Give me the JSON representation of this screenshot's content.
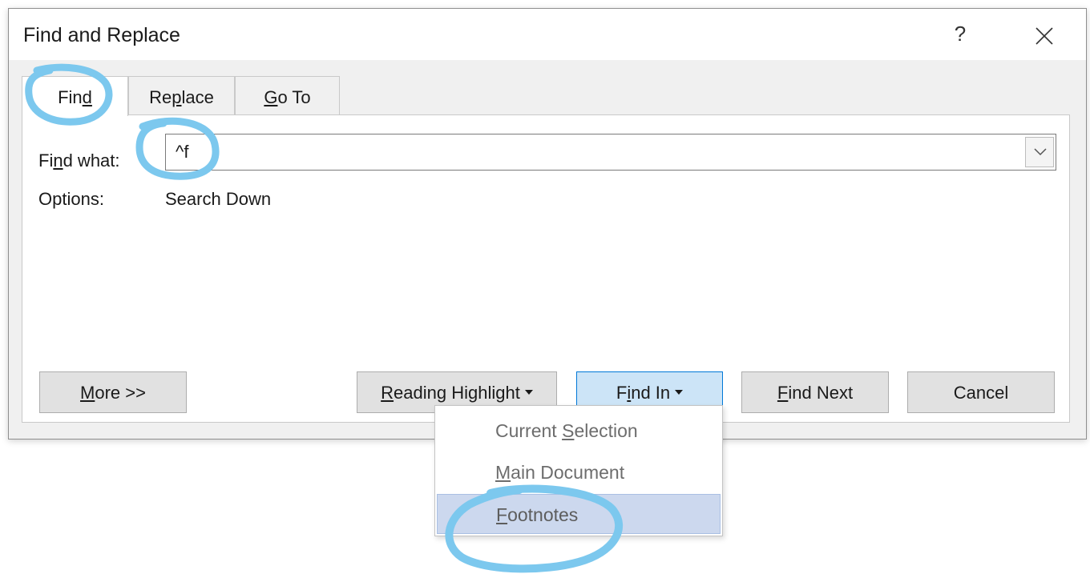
{
  "dialog": {
    "title": "Find and Replace",
    "help_label": "?",
    "close_icon": "close-icon"
  },
  "tabs": [
    {
      "pre": "Fin",
      "ul": "d",
      "post": ""
    },
    {
      "pre": "Re",
      "ul": "p",
      "post": "lace"
    },
    {
      "pre": "",
      "ul": "G",
      "post": "o To"
    }
  ],
  "find": {
    "label_pre": "Fi",
    "label_ul": "n",
    "label_post": "d what:",
    "value": "^f"
  },
  "options": {
    "label": "Options:",
    "value": "Search Down"
  },
  "buttons": {
    "more": {
      "ul": "M",
      "post": "ore >>"
    },
    "reading": {
      "ul": "R",
      "post": "eading Highlight"
    },
    "findin": {
      "pre": "F",
      "ul": "i",
      "post": "nd In"
    },
    "findnext": {
      "ul": "F",
      "post": "ind Next"
    },
    "cancel": "Cancel"
  },
  "menu": {
    "items": [
      {
        "pre": "Current ",
        "ul": "S",
        "post": "election"
      },
      {
        "pre": "",
        "ul": "M",
        "post": "ain Document"
      },
      {
        "pre": "",
        "ul": "F",
        "post": "ootnotes"
      }
    ],
    "selected": "Footnotes"
  },
  "annotation_color": "#7cc8ee"
}
